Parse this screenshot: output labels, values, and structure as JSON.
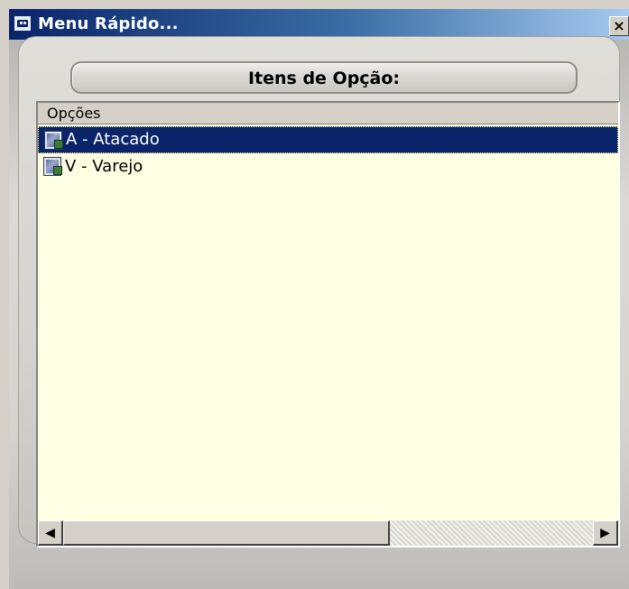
{
  "window": {
    "title": "Menu Rápido...",
    "close_label": "×"
  },
  "header": {
    "title": "Itens de Opção:"
  },
  "list": {
    "column_header": "Opções",
    "items": [
      {
        "label": "A - Atacado",
        "selected": true
      },
      {
        "label": "V - Varejo",
        "selected": false
      }
    ]
  },
  "scrollbar": {
    "left_arrow": "◀",
    "right_arrow": "▶"
  },
  "colors": {
    "titlebar_start": "#0a246a",
    "list_background": "#fefee2",
    "selection": "#0a246a"
  }
}
